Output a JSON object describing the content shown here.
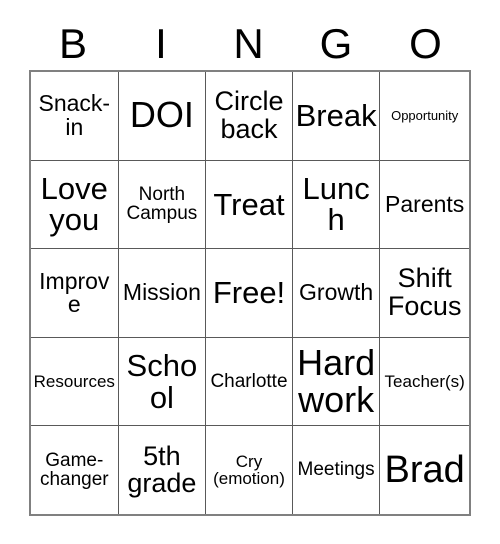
{
  "card": {
    "title_letters": [
      "B",
      "I",
      "N",
      "G",
      "O"
    ],
    "free_space_label": "Free!",
    "grid": [
      [
        {
          "text": "Snack-\nin",
          "size": "lg"
        },
        {
          "text": "DOI",
          "size": "huge"
        },
        {
          "text": "Circle\nback",
          "size": "xl"
        },
        {
          "text": "Break",
          "size": "xxl"
        },
        {
          "text": "Opportunity",
          "size": "xs"
        }
      ],
      [
        {
          "text": "Love\nyou",
          "size": "xxl"
        },
        {
          "text": "North\nCampus",
          "size": "md"
        },
        {
          "text": "Treat",
          "size": "xxl"
        },
        {
          "text": "Lunch",
          "size": "xxl"
        },
        {
          "text": "Parents",
          "size": "lg"
        }
      ],
      [
        {
          "text": "Improve",
          "size": "lg"
        },
        {
          "text": "Mission",
          "size": "lg"
        },
        {
          "text": "Free!",
          "size": "xxl"
        },
        {
          "text": "Growth",
          "size": "lg"
        },
        {
          "text": "Shift\nFocus",
          "size": "xl"
        }
      ],
      [
        {
          "text": "Resources",
          "size": "sm"
        },
        {
          "text": "School",
          "size": "xxl"
        },
        {
          "text": "Charlotte",
          "size": "md"
        },
        {
          "text": "Hard\nwork",
          "size": "huge"
        },
        {
          "text": "Teacher(s)",
          "size": "sm"
        }
      ],
      [
        {
          "text": "Game-\nchanger",
          "size": "md"
        },
        {
          "text": "5th\ngrade",
          "size": "xl"
        },
        {
          "text": "Cry\n(emotion)",
          "size": "sm"
        },
        {
          "text": "Meetings",
          "size": "md"
        },
        {
          "text": "Brad",
          "size": "mega"
        }
      ]
    ]
  },
  "colors": {
    "background": "#ffffff",
    "text": "#000000",
    "grid_outer_border": "#808080",
    "grid_inner_border": "#595959"
  }
}
